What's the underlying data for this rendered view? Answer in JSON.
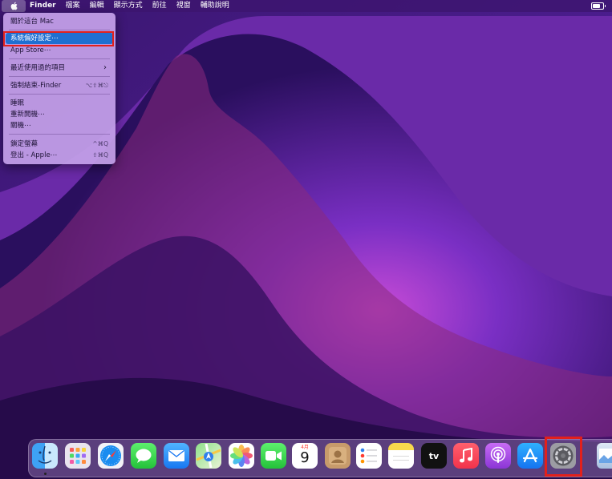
{
  "menubar": {
    "apple_glyph": "",
    "app_name": "Finder",
    "items": [
      "檔案",
      "編輯",
      "顯示方式",
      "前往",
      "視窗",
      "輔助說明"
    ]
  },
  "apple_menu": {
    "about": "關於這台 Mac",
    "system_prefs": "系統偏好設定⋯",
    "app_store": "App Store⋯",
    "recent_items": "最近使用過的項目",
    "force_quit": "強制結束-Finder",
    "force_quit_shortcut": "⌥⇧⌘⎋",
    "sleep": "睡眠",
    "restart": "重新開機⋯",
    "shutdown": "關機⋯",
    "lock_screen": "鎖定螢幕",
    "lock_screen_shortcut": "^⌘Q",
    "logout": "登出 - Apple⋯",
    "logout_shortcut": "⇧⌘Q"
  },
  "dock": {
    "items": [
      "Finder",
      "Launchpad",
      "Safari",
      "Messages",
      "Mail",
      "Maps",
      "Photos",
      "FaceTime",
      "Calendar",
      "Contacts",
      "Reminders",
      "Notes",
      "TV",
      "Music",
      "Podcasts",
      "App Store",
      "System Preferences",
      "Preview"
    ],
    "calendar_month": "4月",
    "calendar_day": "9",
    "tv_label": "tv"
  },
  "colors": {
    "highlight": "#e3201b",
    "menu_selection": "#1f6fd1"
  }
}
